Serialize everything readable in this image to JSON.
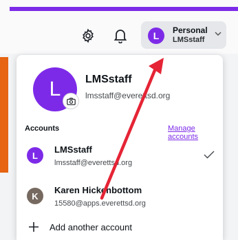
{
  "colors": {
    "accent": "#7d2ae8",
    "orange_strip": "#e66412",
    "second_avatar": "#76695f",
    "annotation_arrow": "#e52435"
  },
  "header": {
    "settings_icon": "gear-icon",
    "notifications_icon": "bell-icon",
    "account_switcher": {
      "avatar_initial": "L",
      "title": "Personal",
      "subtitle": "LMSstaff"
    }
  },
  "profile": {
    "avatar_initial": "L",
    "name": "LMSstaff",
    "email": "lmsstaff@everettsd.org"
  },
  "accounts": {
    "section_label": "Accounts",
    "manage_label": "Manage accounts",
    "items": [
      {
        "initial": "L",
        "name": "LMSstaff",
        "email": "lmsstaff@everettsd.org",
        "selected": true
      },
      {
        "initial": "K",
        "name": "Karen Hickenbottom",
        "email": "15580@apps.everettsd.org",
        "selected": false
      }
    ],
    "add_label": "Add another account"
  }
}
